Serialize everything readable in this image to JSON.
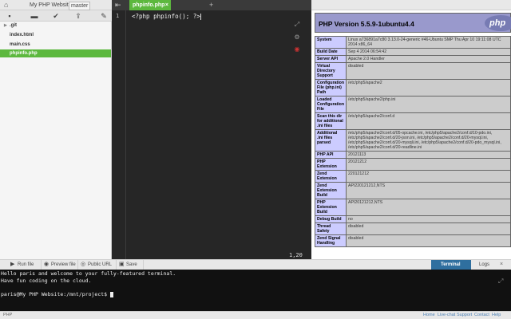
{
  "header": {
    "project_title": "My PHP Website",
    "branch": "master"
  },
  "filetree": {
    "items": [
      {
        "label": ".git",
        "folder": true,
        "active": false
      },
      {
        "label": "index.html",
        "folder": false,
        "active": false
      },
      {
        "label": "main.css",
        "folder": false,
        "active": false
      },
      {
        "label": "phpinfo.php",
        "folder": false,
        "active": true
      }
    ]
  },
  "tabs": {
    "active_tab": "phpinfo.php",
    "close_glyph": "×",
    "add_glyph": "+"
  },
  "editor": {
    "line_number": "1",
    "code": "<?php phpinfo(); ?>",
    "cursor_position": "1,20"
  },
  "preview": {
    "version": "PHP Version 5.5.9-1ubuntu4.4",
    "logo_text": "php",
    "rows": [
      {
        "k": "System",
        "v": "Linux a736891a7c80 3.13.0-24-generic #46-Ubuntu SMP Thu Apr 10 19:11:08 UTC 2014 x86_64"
      },
      {
        "k": "Build Date",
        "v": "Sep 4 2014 06:54:42"
      },
      {
        "k": "Server API",
        "v": "Apache 2.0 Handler"
      },
      {
        "k": "Virtual Directory Support",
        "v": "disabled"
      },
      {
        "k": "Configuration File (php.ini) Path",
        "v": "/etc/php5/apache2"
      },
      {
        "k": "Loaded Configuration File",
        "v": "/etc/php5/apache2/php.ini"
      },
      {
        "k": "Scan this dir for additional .ini files",
        "v": "/etc/php5/apache2/conf.d"
      },
      {
        "k": "Additional .ini files parsed",
        "v": "/etc/php5/apache2/conf.d/05-opcache.ini, /etc/php5/apache2/conf.d/10-pdo.ini, /etc/php5/apache2/conf.d/20-json.ini, /etc/php5/apache2/conf.d/20-mysql.ini, /etc/php5/apache2/conf.d/20-mysqli.ini, /etc/php5/apache2/conf.d/20-pdo_mysql.ini, /etc/php5/apache2/conf.d/20-readline.ini"
      },
      {
        "k": "PHP API",
        "v": "20121113"
      },
      {
        "k": "PHP Extension",
        "v": "20121212"
      },
      {
        "k": "Zend Extension",
        "v": "220121212"
      },
      {
        "k": "Zend Extension Build",
        "v": "API220121212,NTS"
      },
      {
        "k": "PHP Extension Build",
        "v": "API20121212,NTS"
      },
      {
        "k": "Debug Build",
        "v": "no"
      },
      {
        "k": "Thread Safety",
        "v": "disabled"
      },
      {
        "k": "Zend Signal Handling",
        "v": "disabled"
      }
    ]
  },
  "bottombar": {
    "run_file": "Run file",
    "preview_file": "Preview file",
    "public_url": "Public URL",
    "save": "Save",
    "terminal_tab": "Terminal",
    "logs_tab": "Logs"
  },
  "terminal": {
    "lines": [
      "Hello paris and welcome to your fully-featured terminal.",
      "Have fun coding on the cloud.",
      "",
      "paris@My PHP Website:/mnt/project$ "
    ]
  },
  "statusbar": {
    "language": "PHP",
    "links": [
      "Home",
      "Live-chat",
      "Support",
      "Contact",
      "Help"
    ]
  },
  "icons": {
    "home": "home-icon",
    "new_file": "new-file-icon",
    "new_folder": "new-folder-icon",
    "commit": "check-icon",
    "deploy": "upload-icon",
    "settings": "wrench-icon"
  }
}
